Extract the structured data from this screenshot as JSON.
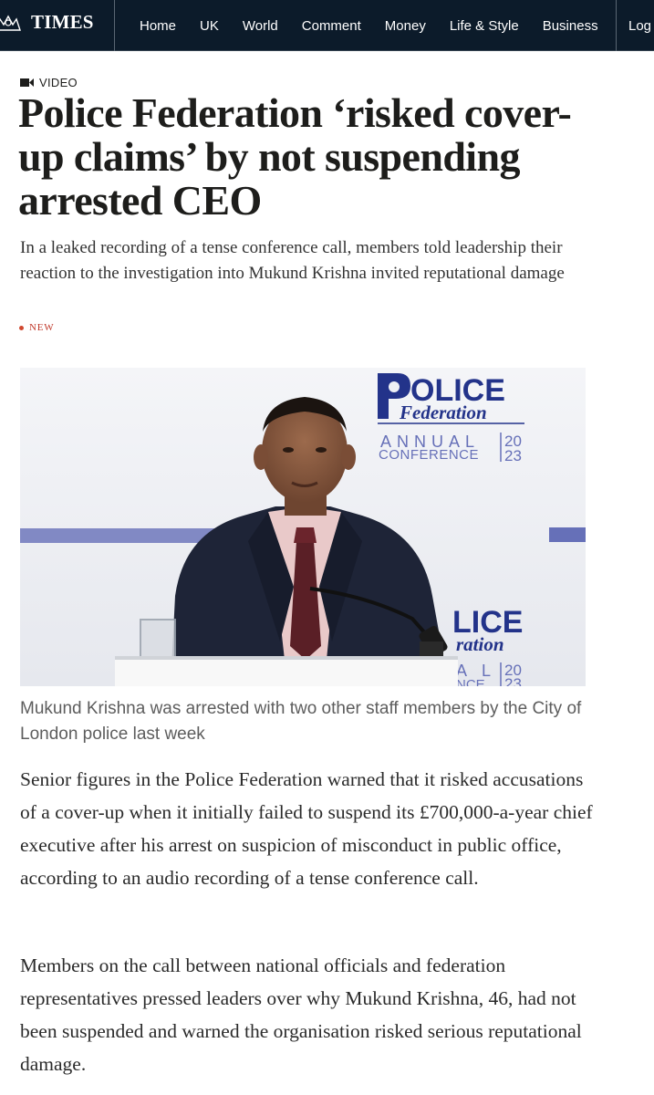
{
  "nav": {
    "masthead": "TIMES",
    "items": [
      "Home",
      "UK",
      "World",
      "Comment",
      "Money",
      "Life & Style",
      "Business"
    ],
    "login": "Log"
  },
  "article": {
    "tag_icon": "video-camera-icon",
    "tag": "VIDEO",
    "headline": "Police Federation ‘risked cover-up claims’ by not suspending arrested CEO",
    "standfirst": "In a leaked recording of a tense conference call, members told leadership their reaction to the investigation into Mukund Krishna invited reputational damage",
    "badge": "NEW",
    "image": {
      "logo_word_police": "OLICE",
      "logo_word_federation": "Federation",
      "logo_annual": "ANNUAL",
      "logo_conference": "CONFERENCE",
      "logo_year_top": "20",
      "logo_year_bottom": "23",
      "logo2_police": "LICE",
      "logo2_federation": "ration",
      "logo2_annual": "A L",
      "logo2_conference": "NCE",
      "logo2_year_top": "20",
      "logo2_year_bottom": "23"
    },
    "caption": "Mukund Krishna was arrested with two other staff members by the City of London police last week",
    "paragraphs": [
      "Senior figures in the Police Federation warned that it risked accusations of a cover-up when it initially failed to suspend its £700,000-a-year chief executive after his arrest on suspicion of misconduct in public office, according to an audio recording of a tense conference call.",
      "Members on the call between national officials and federation representatives pressed leaders over why Mukund Krishna, 46, had not been suspended and warned the organisation risked serious reputational damage."
    ]
  },
  "colors": {
    "nav_bg": "#0c1b2a",
    "brand_navy": "#23338a",
    "brand_purple": "#6670b8",
    "new_red": "#c0392b"
  }
}
